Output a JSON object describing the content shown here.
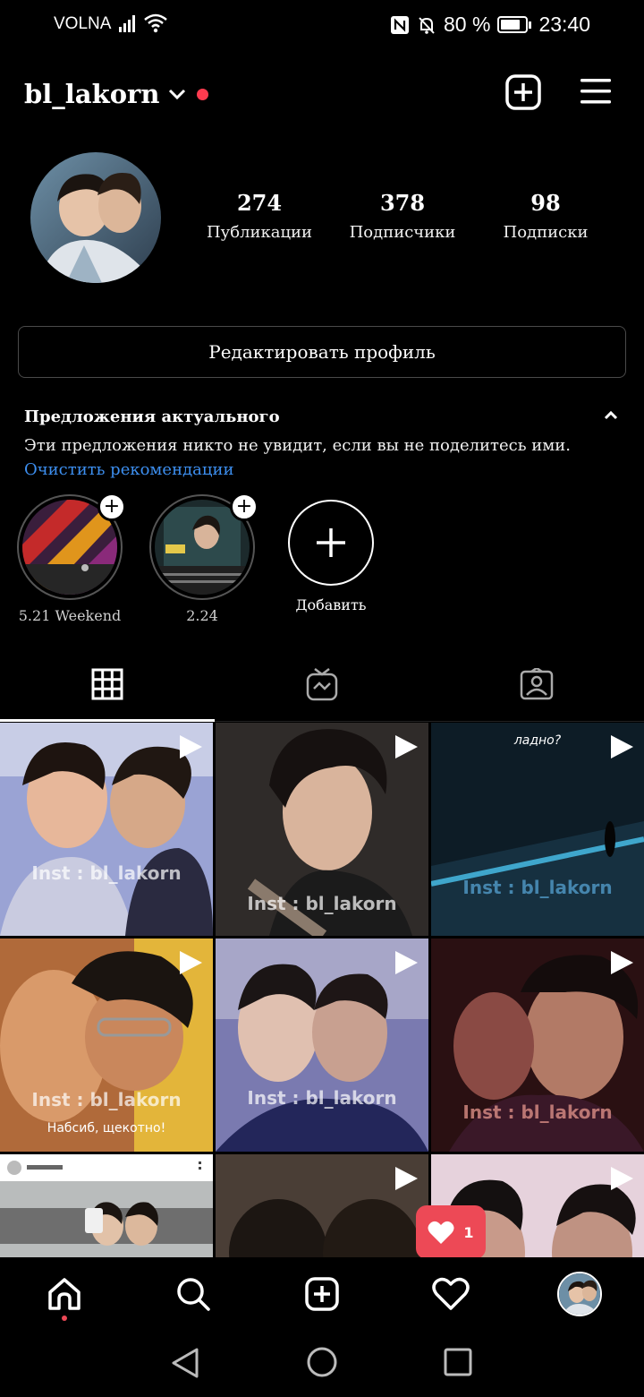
{
  "status_bar": {
    "carrier": "VOLNA",
    "battery_text": "80 %",
    "time": "23:40",
    "battery_level": 0.8
  },
  "header": {
    "username": "bl_lakorn"
  },
  "profile": {
    "stats": [
      {
        "count": "274",
        "label": "Публикации"
      },
      {
        "count": "378",
        "label": "Подписчики"
      },
      {
        "count": "98",
        "label": "Подписки"
      }
    ],
    "edit_button": "Редактировать профиль"
  },
  "suggestions": {
    "title": "Предложения актуального",
    "text": "Эти предложения никто не увидит, если вы не поделитесь ими.",
    "clear_link": "Очистить рекомендации"
  },
  "highlights": [
    {
      "label": "5.21 Weekend"
    },
    {
      "label": "2.24"
    }
  ],
  "add_highlight_label": "Добавить",
  "tabs": [
    {
      "name": "grid",
      "active": true
    },
    {
      "name": "igtv",
      "active": false
    },
    {
      "name": "tagged",
      "active": false
    }
  ],
  "grid": {
    "watermark": "Inst : bl_lakorn",
    "cells": [
      {
        "caption": ""
      },
      {
        "caption": ""
      },
      {
        "caption": "ладно?"
      },
      {
        "caption": "Набсиб, щекотно!"
      },
      {
        "caption": ""
      },
      {
        "caption": ""
      }
    ]
  },
  "notification": {
    "count": "1"
  },
  "colors": {
    "accent_link": "#3d8ff0",
    "notification": "#ed4956"
  }
}
